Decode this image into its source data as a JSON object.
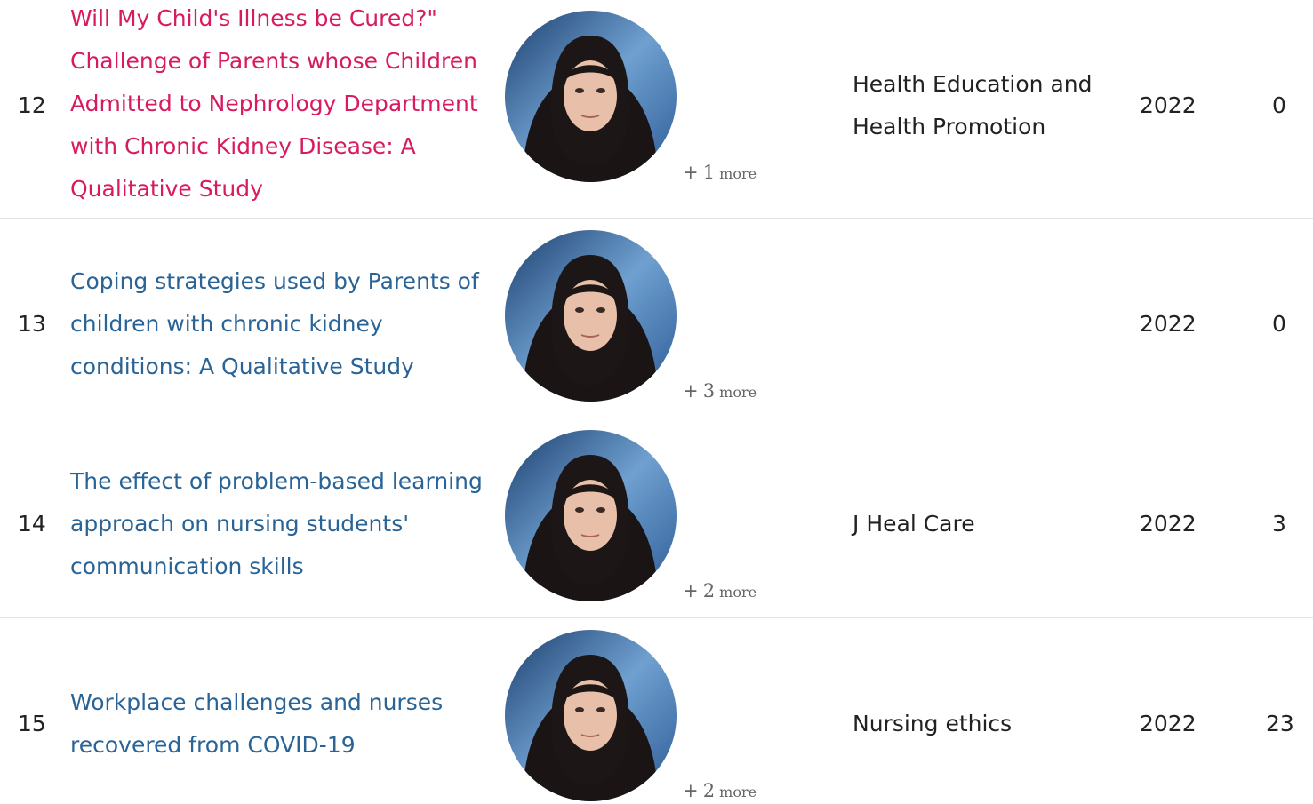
{
  "columns_note": "",
  "rows": [
    {
      "number": "12",
      "title": "Will My Child's Illness be Cured?\" Challenge of Parents whose Children Admitted to Nephrology Department with Chronic Kidney Disease: A Qualitative Study",
      "title_state": "hovered",
      "more_plus": "+",
      "more_count": "1",
      "more_word": "more",
      "journal": "Health Education and Health Promotion",
      "year": "2022",
      "citations": "0"
    },
    {
      "number": "13",
      "title": "Coping strategies used by Parents of children with chronic kidney conditions: A Qualitative Study",
      "title_state": "default",
      "more_plus": "+",
      "more_count": "3",
      "more_word": "more",
      "journal": "",
      "year": "2022",
      "citations": "0"
    },
    {
      "number": "14",
      "title": "The effect of problem-based learning approach on nursing students' communication skills",
      "title_state": "default",
      "more_plus": "+",
      "more_count": "2",
      "more_word": "more",
      "journal": "J Heal Care",
      "year": "2022",
      "citations": "3"
    },
    {
      "number": "15",
      "title": "Workplace challenges and nurses recovered from COVID-19",
      "title_state": "default",
      "more_plus": "+",
      "more_count": "2",
      "more_word": "more",
      "journal": "Nursing ethics",
      "year": "2022",
      "citations": "23"
    }
  ],
  "colors": {
    "link": "#2a6496",
    "link_hover": "#d81b60",
    "divider": "#e3e3e3",
    "text": "#222222"
  },
  "icons": {
    "avatar": "author-photo"
  }
}
